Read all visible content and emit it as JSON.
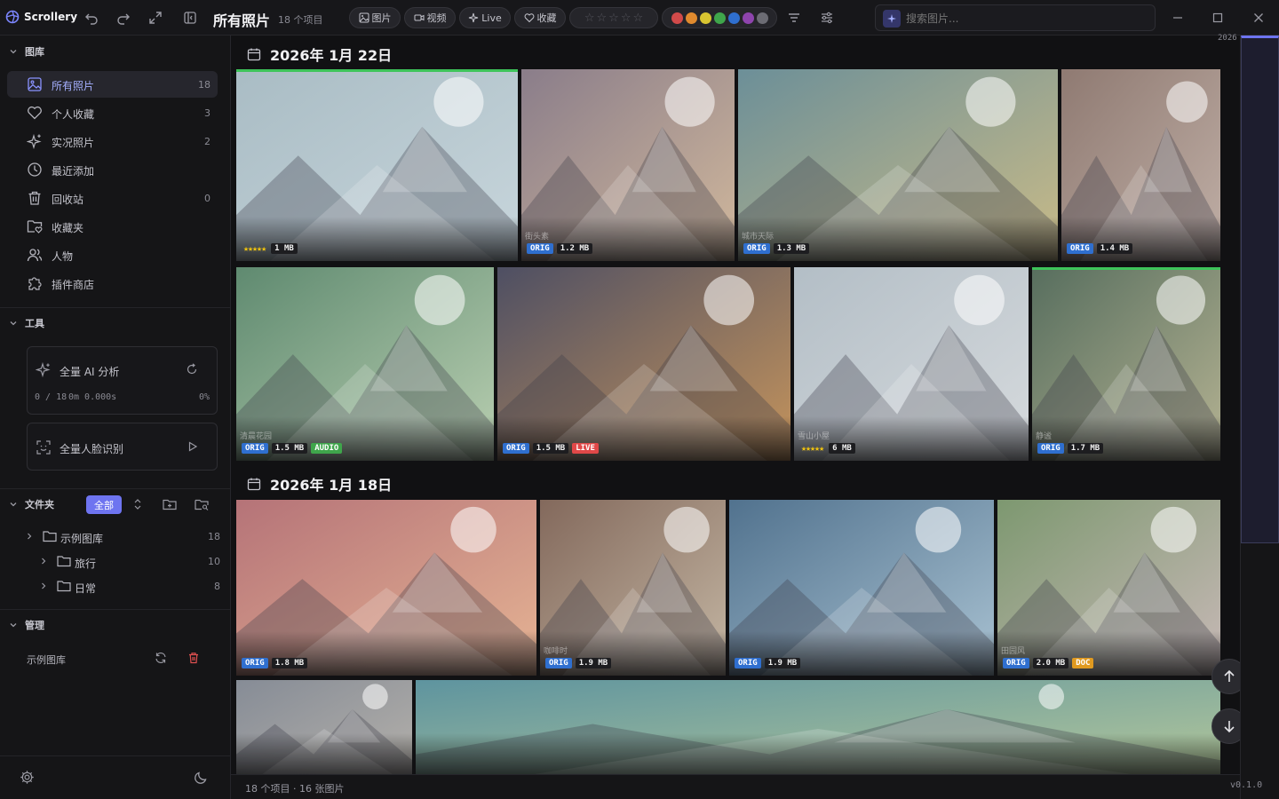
{
  "app": {
    "name": "Scrollery",
    "title": "所有照片",
    "item_count": "18 个项目",
    "version": "v0.1.0"
  },
  "toolbar": {
    "filters": [
      {
        "label": "图片",
        "icon": "image-icon"
      },
      {
        "label": "视频",
        "icon": "video-icon"
      },
      {
        "label": "Live",
        "icon": "sparkle-icon"
      },
      {
        "label": "收藏",
        "icon": "heart-icon"
      }
    ],
    "rating_stars": 5,
    "colors": [
      "#d14a4a",
      "#e08a2e",
      "#d8c431",
      "#3fa64b",
      "#2f6fcf",
      "#8e44ad",
      "#6c6c74"
    ],
    "search_placeholder": "搜索图片..."
  },
  "sidebar": {
    "library_header": "图库",
    "items": [
      {
        "label": "所有照片",
        "count": "18",
        "icon": "image-icon"
      },
      {
        "label": "个人收藏",
        "count": "3",
        "icon": "heart-icon"
      },
      {
        "label": "实况照片",
        "count": "2",
        "icon": "sparkle-icon"
      },
      {
        "label": "最近添加",
        "count": "",
        "icon": "clock-icon"
      },
      {
        "label": "回收站",
        "count": "0",
        "icon": "trash-icon"
      },
      {
        "label": "收藏夹",
        "count": "",
        "icon": "folder-heart-icon"
      },
      {
        "label": "人物",
        "count": "",
        "icon": "people-icon"
      },
      {
        "label": "插件商店",
        "count": "",
        "icon": "puzzle-icon"
      }
    ],
    "tools_header": "工具",
    "ai_analysis": {
      "label": "全量 AI 分析",
      "progress": "0 / 18",
      "elapsed": "0m 0.000s",
      "percent": "0%"
    },
    "face_recognition": {
      "label": "全量人脸识别"
    },
    "folders_header": "文件夹",
    "folders_filter": "全部",
    "folders": [
      {
        "label": "示例图库",
        "count": "18"
      },
      {
        "label": "旅行",
        "count": "10"
      },
      {
        "label": "日常",
        "count": "8"
      }
    ],
    "manage_header": "管理",
    "manage_item": "示例图库"
  },
  "timeline": {
    "year_marker": "2026",
    "groups": [
      {
        "date": "2026年 1月 22日"
      },
      {
        "date": "2026年 1月 18日"
      }
    ]
  },
  "photos": [
    {
      "g": "#9fb0b6",
      "c1": "#a9bcc4",
      "c2": "#c8d6dc",
      "badges": [
        {
          "type": "stars",
          "text": "★★★★★"
        },
        {
          "type": "size",
          "text": "1 MB"
        }
      ],
      "green": true,
      "caption": ""
    },
    {
      "g": "#857a86",
      "c1": "#8a7d8a",
      "c2": "#d1b89c",
      "badges": [
        {
          "type": "orig",
          "text": "ORIG"
        },
        {
          "type": "size",
          "text": "1.2 MB"
        }
      ],
      "green": false,
      "caption": "街头素"
    },
    {
      "g": "#6d8d96",
      "c1": "#6c8f98",
      "c2": "#c9bb88",
      "badges": [
        {
          "type": "orig",
          "text": "ORIG"
        },
        {
          "type": "size",
          "text": "1.3 MB"
        }
      ],
      "green": false,
      "caption": "城市天际"
    },
    {
      "g": "#98857f",
      "c1": "#8f7a72",
      "c2": "#c0afa6",
      "badges": [
        {
          "type": "orig",
          "text": "ORIG"
        },
        {
          "type": "size",
          "text": "1.4 MB"
        }
      ],
      "green": false,
      "caption": ""
    },
    {
      "g": "#6a8f79",
      "c1": "#5f8a70",
      "c2": "#b9cfb1",
      "badges": [
        {
          "type": "orig",
          "text": "ORIG"
        },
        {
          "type": "size",
          "text": "1.5 MB"
        },
        {
          "type": "audio",
          "text": "AUDIO"
        }
      ],
      "green": false,
      "caption": "清晨花园"
    },
    {
      "g": "#5d5868",
      "c1": "#4e4f63",
      "c2": "#c5945c",
      "badges": [
        {
          "type": "orig",
          "text": "ORIG"
        },
        {
          "type": "size",
          "text": "1.5 MB"
        },
        {
          "type": "live",
          "text": "LIVE"
        }
      ],
      "green": false,
      "caption": ""
    },
    {
      "g": "#aab4bb",
      "c1": "#b3bec6",
      "c2": "#d6dadd",
      "badges": [
        {
          "type": "stars",
          "text": "★★★★★"
        },
        {
          "type": "size",
          "text": "6 MB"
        }
      ],
      "green": false,
      "caption": "雪山小屋"
    },
    {
      "g": "#5e7163",
      "c1": "#576e5e",
      "c2": "#b4b292",
      "badges": [
        {
          "type": "orig",
          "text": "ORIG"
        },
        {
          "type": "size",
          "text": "1.7 MB"
        }
      ],
      "green": true,
      "caption": "静谧"
    },
    {
      "g": "#b98079",
      "c1": "#b57378",
      "c2": "#e6b494",
      "badges": [
        {
          "type": "orig",
          "text": "ORIG"
        },
        {
          "type": "size",
          "text": "1.8 MB"
        }
      ],
      "green": false,
      "caption": ""
    },
    {
      "g": "#8b7565",
      "c1": "#83695c",
      "c2": "#c4b6a3",
      "badges": [
        {
          "type": "orig",
          "text": "ORIG"
        },
        {
          "type": "size",
          "text": "1.9 MB"
        }
      ],
      "green": false,
      "caption": "咖啡时"
    },
    {
      "g": "#5e7e97",
      "c1": "#51728e",
      "c2": "#a9c2d2",
      "badges": [
        {
          "type": "orig",
          "text": "ORIG"
        },
        {
          "type": "size",
          "text": "1.9 MB"
        }
      ],
      "green": false,
      "caption": ""
    },
    {
      "g": "#8e9d7e",
      "c1": "#7d9870",
      "c2": "#c8b9b7",
      "badges": [
        {
          "type": "orig",
          "text": "ORIG"
        },
        {
          "type": "size",
          "text": "2.0 MB"
        },
        {
          "type": "doc",
          "text": "DOC"
        }
      ],
      "green": false,
      "caption": "田园风"
    },
    {
      "g": "#8e949c",
      "c1": "#868c96",
      "c2": "#b5b1ab",
      "badges": [],
      "green": false,
      "caption": ""
    },
    {
      "g": "#6f9aa0",
      "c1": "#5e949f",
      "c2": "#b5c89a",
      "badges": [],
      "green": false,
      "caption": ""
    }
  ],
  "status": {
    "text": "18 个项目 · 16 张图片"
  }
}
